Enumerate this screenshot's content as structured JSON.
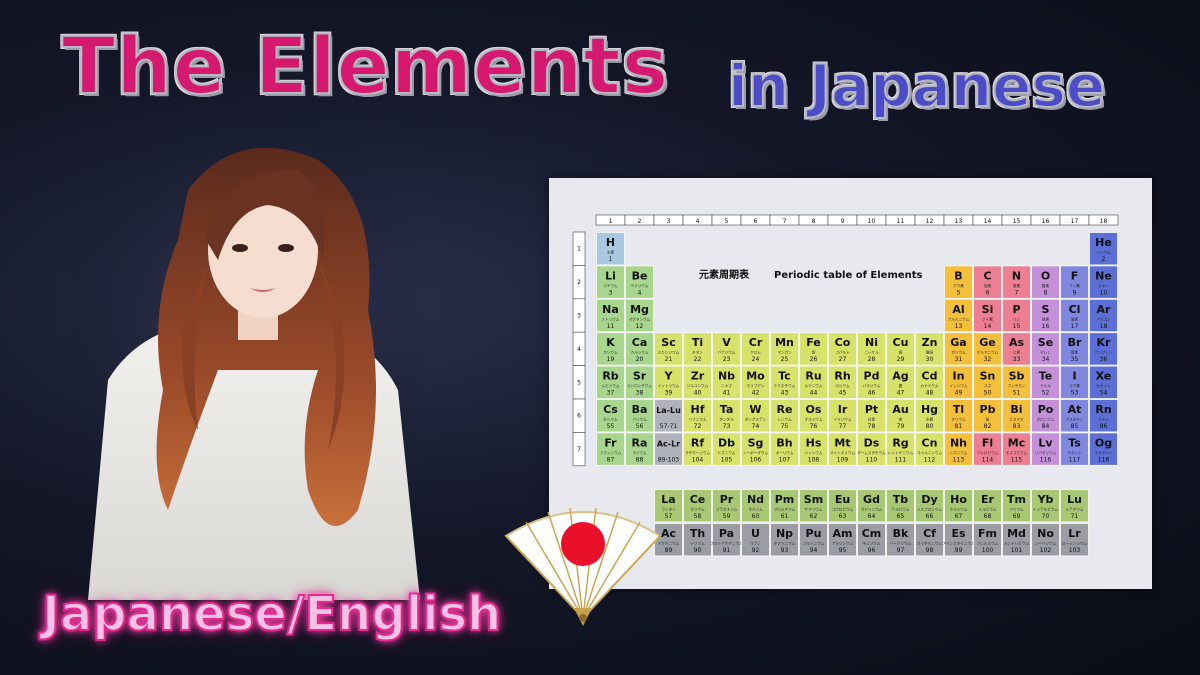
{
  "title": {
    "main": "The Elements",
    "sub": "in Japanese"
  },
  "language_label": "Japanese/English",
  "periodic_table": {
    "heading_jp": "元素周期表",
    "heading_en": "Periodic table of Elements",
    "groups": [
      "1",
      "2",
      "3",
      "4",
      "5",
      "6",
      "7",
      "8",
      "9",
      "10",
      "11",
      "12",
      "13",
      "14",
      "15",
      "16",
      "17",
      "18"
    ],
    "periods": [
      "1",
      "2",
      "3",
      "4",
      "5",
      "6",
      "7"
    ],
    "colors": {
      "alkali": "#a8d68c",
      "alkaline": "#a8d68c",
      "transition": "#d7e26a",
      "post": "#f4c03c",
      "metalloid": "#f4c03c",
      "nonmetal": "#ec7f92",
      "chalcogen": "#c491d8",
      "halogen": "#7f88de",
      "noble": "#5b6fd6",
      "hydrogen": "#a8c9e0",
      "placeholder": "#b0b3bb",
      "lanthanide": "#a9c873",
      "actinide": "#9a9da4"
    },
    "elements": [
      {
        "sym": "H",
        "jp": "水素",
        "num": "1",
        "r": 1,
        "c": 1,
        "cat": "hydrogen"
      },
      {
        "sym": "He",
        "jp": "ヘリウム",
        "num": "2",
        "r": 1,
        "c": 18,
        "cat": "noble"
      },
      {
        "sym": "Li",
        "jp": "リチウム",
        "num": "3",
        "r": 2,
        "c": 1,
        "cat": "alkali"
      },
      {
        "sym": "Be",
        "jp": "ベリリウム",
        "num": "4",
        "r": 2,
        "c": 2,
        "cat": "alkaline"
      },
      {
        "sym": "B",
        "jp": "ホウ素",
        "num": "5",
        "r": 2,
        "c": 13,
        "cat": "post"
      },
      {
        "sym": "C",
        "jp": "炭素",
        "num": "6",
        "r": 2,
        "c": 14,
        "cat": "nonmetal"
      },
      {
        "sym": "N",
        "jp": "窒素",
        "num": "7",
        "r": 2,
        "c": 15,
        "cat": "nonmetal"
      },
      {
        "sym": "O",
        "jp": "酸素",
        "num": "8",
        "r": 2,
        "c": 16,
        "cat": "chalcogen"
      },
      {
        "sym": "F",
        "jp": "フッ素",
        "num": "9",
        "r": 2,
        "c": 17,
        "cat": "halogen"
      },
      {
        "sym": "Ne",
        "jp": "ネオン",
        "num": "10",
        "r": 2,
        "c": 18,
        "cat": "noble"
      },
      {
        "sym": "Na",
        "jp": "ナトリウム",
        "num": "11",
        "r": 3,
        "c": 1,
        "cat": "alkali"
      },
      {
        "sym": "Mg",
        "jp": "マグネシウム",
        "num": "12",
        "r": 3,
        "c": 2,
        "cat": "alkaline"
      },
      {
        "sym": "Al",
        "jp": "アルミニウム",
        "num": "13",
        "r": 3,
        "c": 13,
        "cat": "post"
      },
      {
        "sym": "Si",
        "jp": "ケイ素",
        "num": "14",
        "r": 3,
        "c": 14,
        "cat": "nonmetal"
      },
      {
        "sym": "P",
        "jp": "リン",
        "num": "15",
        "r": 3,
        "c": 15,
        "cat": "nonmetal"
      },
      {
        "sym": "S",
        "jp": "硫黄",
        "num": "16",
        "r": 3,
        "c": 16,
        "cat": "chalcogen"
      },
      {
        "sym": "Cl",
        "jp": "塩素",
        "num": "17",
        "r": 3,
        "c": 17,
        "cat": "halogen"
      },
      {
        "sym": "Ar",
        "jp": "アルゴン",
        "num": "18",
        "r": 3,
        "c": 18,
        "cat": "noble"
      },
      {
        "sym": "K",
        "jp": "カリウム",
        "num": "19",
        "r": 4,
        "c": 1,
        "cat": "alkali"
      },
      {
        "sym": "Ca",
        "jp": "カルシウム",
        "num": "20",
        "r": 4,
        "c": 2,
        "cat": "alkaline"
      },
      {
        "sym": "Sc",
        "jp": "スカンジウム",
        "num": "21",
        "r": 4,
        "c": 3,
        "cat": "transition"
      },
      {
        "sym": "Ti",
        "jp": "チタン",
        "num": "22",
        "r": 4,
        "c": 4,
        "cat": "transition"
      },
      {
        "sym": "V",
        "jp": "バナジウム",
        "num": "23",
        "r": 4,
        "c": 5,
        "cat": "transition"
      },
      {
        "sym": "Cr",
        "jp": "クロム",
        "num": "24",
        "r": 4,
        "c": 6,
        "cat": "transition"
      },
      {
        "sym": "Mn",
        "jp": "マンガン",
        "num": "25",
        "r": 4,
        "c": 7,
        "cat": "transition"
      },
      {
        "sym": "Fe",
        "jp": "鉄",
        "num": "26",
        "r": 4,
        "c": 8,
        "cat": "transition"
      },
      {
        "sym": "Co",
        "jp": "コバルト",
        "num": "27",
        "r": 4,
        "c": 9,
        "cat": "transition"
      },
      {
        "sym": "Ni",
        "jp": "ニッケル",
        "num": "28",
        "r": 4,
        "c": 10,
        "cat": "transition"
      },
      {
        "sym": "Cu",
        "jp": "銅",
        "num": "29",
        "r": 4,
        "c": 11,
        "cat": "transition"
      },
      {
        "sym": "Zn",
        "jp": "亜鉛",
        "num": "30",
        "r": 4,
        "c": 12,
        "cat": "transition"
      },
      {
        "sym": "Ga",
        "jp": "ガリウム",
        "num": "31",
        "r": 4,
        "c": 13,
        "cat": "post"
      },
      {
        "sym": "Ge",
        "jp": "ゲルマニウム",
        "num": "32",
        "r": 4,
        "c": 14,
        "cat": "post"
      },
      {
        "sym": "As",
        "jp": "ヒ素",
        "num": "33",
        "r": 4,
        "c": 15,
        "cat": "nonmetal"
      },
      {
        "sym": "Se",
        "jp": "セレン",
        "num": "34",
        "r": 4,
        "c": 16,
        "cat": "chalcogen"
      },
      {
        "sym": "Br",
        "jp": "臭素",
        "num": "35",
        "r": 4,
        "c": 17,
        "cat": "halogen"
      },
      {
        "sym": "Kr",
        "jp": "クリプトン",
        "num": "36",
        "r": 4,
        "c": 18,
        "cat": "noble"
      },
      {
        "sym": "Rb",
        "jp": "ルビジウム",
        "num": "37",
        "r": 5,
        "c": 1,
        "cat": "alkali"
      },
      {
        "sym": "Sr",
        "jp": "ストロンチウム",
        "num": "38",
        "r": 5,
        "c": 2,
        "cat": "alkaline"
      },
      {
        "sym": "Y",
        "jp": "イットリウム",
        "num": "39",
        "r": 5,
        "c": 3,
        "cat": "transition"
      },
      {
        "sym": "Zr",
        "jp": "ジルコニウム",
        "num": "40",
        "r": 5,
        "c": 4,
        "cat": "transition"
      },
      {
        "sym": "Nb",
        "jp": "ニオブ",
        "num": "41",
        "r": 5,
        "c": 5,
        "cat": "transition"
      },
      {
        "sym": "Mo",
        "jp": "モリブデン",
        "num": "42",
        "r": 5,
        "c": 6,
        "cat": "transition"
      },
      {
        "sym": "Tc",
        "jp": "テクネチウム",
        "num": "43",
        "r": 5,
        "c": 7,
        "cat": "transition"
      },
      {
        "sym": "Ru",
        "jp": "ルテニウム",
        "num": "44",
        "r": 5,
        "c": 8,
        "cat": "transition"
      },
      {
        "sym": "Rh",
        "jp": "ロジウム",
        "num": "45",
        "r": 5,
        "c": 9,
        "cat": "transition"
      },
      {
        "sym": "Pd",
        "jp": "パラジウム",
        "num": "46",
        "r": 5,
        "c": 10,
        "cat": "transition"
      },
      {
        "sym": "Ag",
        "jp": "銀",
        "num": "47",
        "r": 5,
        "c": 11,
        "cat": "transition"
      },
      {
        "sym": "Cd",
        "jp": "カドミウム",
        "num": "48",
        "r": 5,
        "c": 12,
        "cat": "transition"
      },
      {
        "sym": "In",
        "jp": "インジウム",
        "num": "49",
        "r": 5,
        "c": 13,
        "cat": "post"
      },
      {
        "sym": "Sn",
        "jp": "スズ",
        "num": "50",
        "r": 5,
        "c": 14,
        "cat": "post"
      },
      {
        "sym": "Sb",
        "jp": "アンチモン",
        "num": "51",
        "r": 5,
        "c": 15,
        "cat": "post"
      },
      {
        "sym": "Te",
        "jp": "テルル",
        "num": "52",
        "r": 5,
        "c": 16,
        "cat": "chalcogen"
      },
      {
        "sym": "I",
        "jp": "ヨウ素",
        "num": "53",
        "r": 5,
        "c": 17,
        "cat": "halogen"
      },
      {
        "sym": "Xe",
        "jp": "キセノン",
        "num": "54",
        "r": 5,
        "c": 18,
        "cat": "noble"
      },
      {
        "sym": "Cs",
        "jp": "セシウム",
        "num": "55",
        "r": 6,
        "c": 1,
        "cat": "alkali"
      },
      {
        "sym": "Ba",
        "jp": "バリウム",
        "num": "56",
        "r": 6,
        "c": 2,
        "cat": "alkaline"
      },
      {
        "sym": "La-Lu",
        "jp": "",
        "num": "57-71",
        "r": 6,
        "c": 3,
        "cat": "placeholder"
      },
      {
        "sym": "Hf",
        "jp": "ハフニウム",
        "num": "72",
        "r": 6,
        "c": 4,
        "cat": "transition"
      },
      {
        "sym": "Ta",
        "jp": "タンタル",
        "num": "73",
        "r": 6,
        "c": 5,
        "cat": "transition"
      },
      {
        "sym": "W",
        "jp": "タングステン",
        "num": "74",
        "r": 6,
        "c": 6,
        "cat": "transition"
      },
      {
        "sym": "Re",
        "jp": "レニウム",
        "num": "75",
        "r": 6,
        "c": 7,
        "cat": "transition"
      },
      {
        "sym": "Os",
        "jp": "オスミウム",
        "num": "76",
        "r": 6,
        "c": 8,
        "cat": "transition"
      },
      {
        "sym": "Ir",
        "jp": "イリジウム",
        "num": "77",
        "r": 6,
        "c": 9,
        "cat": "transition"
      },
      {
        "sym": "Pt",
        "jp": "白金",
        "num": "78",
        "r": 6,
        "c": 10,
        "cat": "transition"
      },
      {
        "sym": "Au",
        "jp": "金",
        "num": "79",
        "r": 6,
        "c": 11,
        "cat": "transition"
      },
      {
        "sym": "Hg",
        "jp": "水銀",
        "num": "80",
        "r": 6,
        "c": 12,
        "cat": "transition"
      },
      {
        "sym": "Tl",
        "jp": "タリウム",
        "num": "81",
        "r": 6,
        "c": 13,
        "cat": "post"
      },
      {
        "sym": "Pb",
        "jp": "鉛",
        "num": "82",
        "r": 6,
        "c": 14,
        "cat": "post"
      },
      {
        "sym": "Bi",
        "jp": "ビスマス",
        "num": "83",
        "r": 6,
        "c": 15,
        "cat": "post"
      },
      {
        "sym": "Po",
        "jp": "ポロニウム",
        "num": "84",
        "r": 6,
        "c": 16,
        "cat": "chalcogen"
      },
      {
        "sym": "At",
        "jp": "アスタチン",
        "num": "85",
        "r": 6,
        "c": 17,
        "cat": "halogen"
      },
      {
        "sym": "Rn",
        "jp": "ラドン",
        "num": "86",
        "r": 6,
        "c": 18,
        "cat": "noble"
      },
      {
        "sym": "Fr",
        "jp": "フランシウム",
        "num": "87",
        "r": 7,
        "c": 1,
        "cat": "alkali"
      },
      {
        "sym": "Ra",
        "jp": "ラジウム",
        "num": "88",
        "r": 7,
        "c": 2,
        "cat": "alkaline"
      },
      {
        "sym": "Ac-Lr",
        "jp": "",
        "num": "89-103",
        "r": 7,
        "c": 3,
        "cat": "placeholder"
      },
      {
        "sym": "Rf",
        "jp": "ラザホージウム",
        "num": "104",
        "r": 7,
        "c": 4,
        "cat": "transition"
      },
      {
        "sym": "Db",
        "jp": "ドブニウム",
        "num": "105",
        "r": 7,
        "c": 5,
        "cat": "transition"
      },
      {
        "sym": "Sg",
        "jp": "シーボーギウム",
        "num": "106",
        "r": 7,
        "c": 6,
        "cat": "transition"
      },
      {
        "sym": "Bh",
        "jp": "ボーリウム",
        "num": "107",
        "r": 7,
        "c": 7,
        "cat": "transition"
      },
      {
        "sym": "Hs",
        "jp": "ハッシウム",
        "num": "108",
        "r": 7,
        "c": 8,
        "cat": "transition"
      },
      {
        "sym": "Mt",
        "jp": "マイトネリウム",
        "num": "109",
        "r": 7,
        "c": 9,
        "cat": "transition"
      },
      {
        "sym": "Ds",
        "jp": "ダームスタチウム",
        "num": "110",
        "r": 7,
        "c": 10,
        "cat": "transition"
      },
      {
        "sym": "Rg",
        "jp": "レントゲニウム",
        "num": "111",
        "r": 7,
        "c": 11,
        "cat": "transition"
      },
      {
        "sym": "Cn",
        "jp": "コペルニシウム",
        "num": "112",
        "r": 7,
        "c": 12,
        "cat": "transition"
      },
      {
        "sym": "Nh",
        "jp": "ニホニウム",
        "num": "113",
        "r": 7,
        "c": 13,
        "cat": "post"
      },
      {
        "sym": "Fl",
        "jp": "フレロビウム",
        "num": "114",
        "r": 7,
        "c": 14,
        "cat": "nonmetal"
      },
      {
        "sym": "Mc",
        "jp": "モスコビウム",
        "num": "115",
        "r": 7,
        "c": 15,
        "cat": "nonmetal"
      },
      {
        "sym": "Lv",
        "jp": "リバモリウム",
        "num": "116",
        "r": 7,
        "c": 16,
        "cat": "chalcogen"
      },
      {
        "sym": "Ts",
        "jp": "テネシン",
        "num": "117",
        "r": 7,
        "c": 17,
        "cat": "halogen"
      },
      {
        "sym": "Og",
        "jp": "オガネソン",
        "num": "118",
        "r": 7,
        "c": 18,
        "cat": "noble"
      }
    ],
    "lanthanides": [
      {
        "sym": "La",
        "jp": "ランタン",
        "num": "57"
      },
      {
        "sym": "Ce",
        "jp": "セリウム",
        "num": "58"
      },
      {
        "sym": "Pr",
        "jp": "プラセオジム",
        "num": "59"
      },
      {
        "sym": "Nd",
        "jp": "ネオジム",
        "num": "60"
      },
      {
        "sym": "Pm",
        "jp": "プロメチウム",
        "num": "61"
      },
      {
        "sym": "Sm",
        "jp": "サマリウム",
        "num": "62"
      },
      {
        "sym": "Eu",
        "jp": "ユウロピウム",
        "num": "63"
      },
      {
        "sym": "Gd",
        "jp": "ガドリニウム",
        "num": "64"
      },
      {
        "sym": "Tb",
        "jp": "テルビウム",
        "num": "65"
      },
      {
        "sym": "Dy",
        "jp": "ジスプロシウム",
        "num": "66"
      },
      {
        "sym": "Ho",
        "jp": "ホルミウム",
        "num": "67"
      },
      {
        "sym": "Er",
        "jp": "エルビウム",
        "num": "68"
      },
      {
        "sym": "Tm",
        "jp": "ツリウム",
        "num": "69"
      },
      {
        "sym": "Yb",
        "jp": "イッテルビウム",
        "num": "70"
      },
      {
        "sym": "Lu",
        "jp": "ルテチウム",
        "num": "71"
      }
    ],
    "actinides": [
      {
        "sym": "Ac",
        "jp": "アクチニウム",
        "num": "89"
      },
      {
        "sym": "Th",
        "jp": "トリウム",
        "num": "90"
      },
      {
        "sym": "Pa",
        "jp": "プロトアクチニウム",
        "num": "91"
      },
      {
        "sym": "U",
        "jp": "ウラン",
        "num": "92"
      },
      {
        "sym": "Np",
        "jp": "ネプツニウム",
        "num": "93"
      },
      {
        "sym": "Pu",
        "jp": "プルトニウム",
        "num": "94"
      },
      {
        "sym": "Am",
        "jp": "アメリシウム",
        "num": "95"
      },
      {
        "sym": "Cm",
        "jp": "キュリウム",
        "num": "96"
      },
      {
        "sym": "Bk",
        "jp": "バークリウム",
        "num": "97"
      },
      {
        "sym": "Cf",
        "jp": "カリホルニウム",
        "num": "98"
      },
      {
        "sym": "Es",
        "jp": "アインスタイニウム",
        "num": "99"
      },
      {
        "sym": "Fm",
        "jp": "フェルミウム",
        "num": "100"
      },
      {
        "sym": "Md",
        "jp": "メンデレビウム",
        "num": "101"
      },
      {
        "sym": "No",
        "jp": "ノーベリウム",
        "num": "102"
      },
      {
        "sym": "Lr",
        "jp": "ローレンシウム",
        "num": "103"
      }
    ]
  },
  "fan": {
    "colors": {
      "paper": "#ffffff",
      "sun": "#e8102a",
      "ribs": "#c8a24a"
    }
  }
}
